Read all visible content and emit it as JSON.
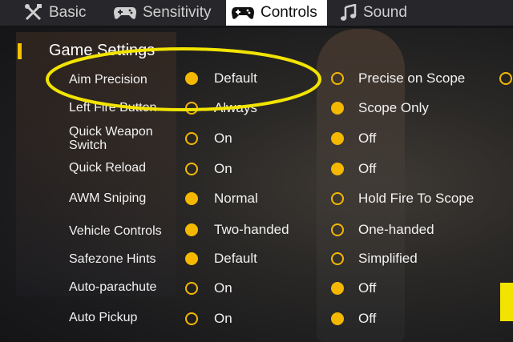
{
  "tabs": [
    {
      "label": "Basic",
      "icon": "tools-icon"
    },
    {
      "label": "Sensitivity",
      "icon": "gamepad-icon"
    },
    {
      "label": "Controls",
      "icon": "gamepad-icon"
    },
    {
      "label": "Sound",
      "icon": "music-note-icon"
    }
  ],
  "active_tab": "Controls",
  "section_title": "Game Settings",
  "accent_color": "#f4b800",
  "annotation_color": "#f2e400",
  "settings": [
    {
      "label": "Aim Precision",
      "option1": "Default",
      "option2": "Precise on Scope",
      "selected": 1
    },
    {
      "label": "Left Fire Button",
      "option1": "Always",
      "option2": "Scope Only",
      "selected": 2
    },
    {
      "label": "Quick Weapon Switch",
      "option1": "On",
      "option2": "Off",
      "selected": 2
    },
    {
      "label": "Quick Reload",
      "option1": "On",
      "option2": "Off",
      "selected": 2
    },
    {
      "label": "AWM Sniping",
      "option1": "Normal",
      "option2": "Hold Fire To Scope",
      "selected": 1
    },
    {
      "label": "Vehicle Controls",
      "option1": "Two-handed",
      "option2": "One-handed",
      "selected": 1
    },
    {
      "label": "Safezone Hints",
      "option1": "Default",
      "option2": "Simplified",
      "selected": 1
    },
    {
      "label": "Auto-parachute",
      "option1": "On",
      "option2": "Off",
      "selected": 2
    },
    {
      "label": "Auto Pickup",
      "option1": "On",
      "option2": "Off",
      "selected": 2
    }
  ]
}
